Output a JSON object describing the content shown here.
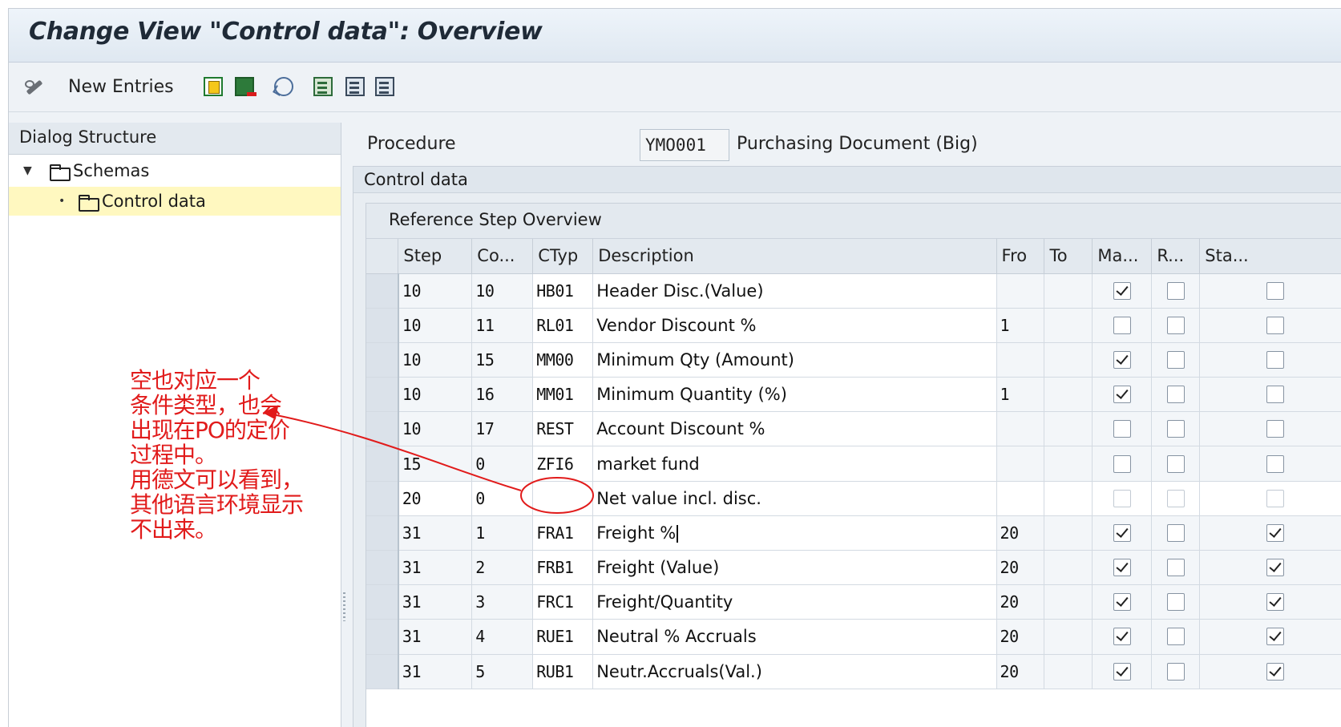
{
  "window": {
    "title": "Change View \"Control data\": Overview"
  },
  "toolbar": {
    "new_entries_label": "New Entries",
    "icons": [
      "display-change-icon",
      "copy-icon",
      "delete-icon",
      "undo-icon",
      "select-all-icon",
      "select-block-icon",
      "deselect-all-icon"
    ]
  },
  "dialog_structure": {
    "header": "Dialog Structure",
    "items": [
      {
        "label": "Schemas",
        "level": 0,
        "expanded": true,
        "selected": false
      },
      {
        "label": "Control data",
        "level": 1,
        "selected": true
      }
    ]
  },
  "procedure": {
    "label": "Procedure",
    "value": "YMO001",
    "description": "Purchasing Document (Big)"
  },
  "control_data": {
    "group_title": "Control data",
    "subgroup_title": "Reference Step Overview",
    "columns": [
      "Step",
      "Co...",
      "CTyp",
      "Description",
      "Fro",
      "To",
      "Ma...",
      "R...",
      "Sta..."
    ],
    "rows": [
      {
        "step": "10",
        "co": "10",
        "ctyp": "HB01",
        "desc": "Header Disc.(Value)",
        "fro": "",
        "to": "",
        "ma": true,
        "r": false,
        "sta": false
      },
      {
        "step": "10",
        "co": "11",
        "ctyp": "RL01",
        "desc": "Vendor Discount %",
        "fro": "1",
        "to": "",
        "ma": false,
        "r": false,
        "sta": false
      },
      {
        "step": "10",
        "co": "15",
        "ctyp": "MM00",
        "desc": "Minimum Qty (Amount)",
        "fro": "",
        "to": "",
        "ma": true,
        "r": false,
        "sta": false
      },
      {
        "step": "10",
        "co": "16",
        "ctyp": "MM01",
        "desc": "Minimum Quantity (%)",
        "fro": "1",
        "to": "",
        "ma": true,
        "r": false,
        "sta": false
      },
      {
        "step": "10",
        "co": "17",
        "ctyp": "REST",
        "desc": "Account Discount %",
        "fro": "",
        "to": "",
        "ma": false,
        "r": false,
        "sta": false
      },
      {
        "step": "15",
        "co": "0",
        "ctyp": "ZFI6",
        "desc": "market fund",
        "fro": "",
        "to": "",
        "ma": false,
        "r": false,
        "sta": false
      },
      {
        "step": "20",
        "co": "0",
        "ctyp": "",
        "desc": "Net value incl. disc.",
        "fro": "",
        "to": "",
        "ma": false,
        "r": false,
        "sta": false
      },
      {
        "step": "31",
        "co": "1",
        "ctyp": "FRA1",
        "desc": "Freight %",
        "fro": "20",
        "to": "",
        "ma": true,
        "r": false,
        "sta": true
      },
      {
        "step": "31",
        "co": "2",
        "ctyp": "FRB1",
        "desc": "Freight (Value)",
        "fro": "20",
        "to": "",
        "ma": true,
        "r": false,
        "sta": true
      },
      {
        "step": "31",
        "co": "3",
        "ctyp": "FRC1",
        "desc": "Freight/Quantity",
        "fro": "20",
        "to": "",
        "ma": true,
        "r": false,
        "sta": true
      },
      {
        "step": "31",
        "co": "4",
        "ctyp": "RUE1",
        "desc": "Neutral % Accruals",
        "fro": "20",
        "to": "",
        "ma": true,
        "r": false,
        "sta": true
      },
      {
        "step": "31",
        "co": "5",
        "ctyp": "RUB1",
        "desc": "Neutr.Accruals(Val.)",
        "fro": "20",
        "to": "",
        "ma": true,
        "r": false,
        "sta": true
      }
    ]
  },
  "annotation": {
    "color": "#e11b1b",
    "lines": [
      "空也对应一个",
      "条件类型，也会",
      "出现在PO的定价",
      "过程中。",
      "用德文可以看到，",
      "其他语言环境显示",
      "不出来。"
    ]
  }
}
